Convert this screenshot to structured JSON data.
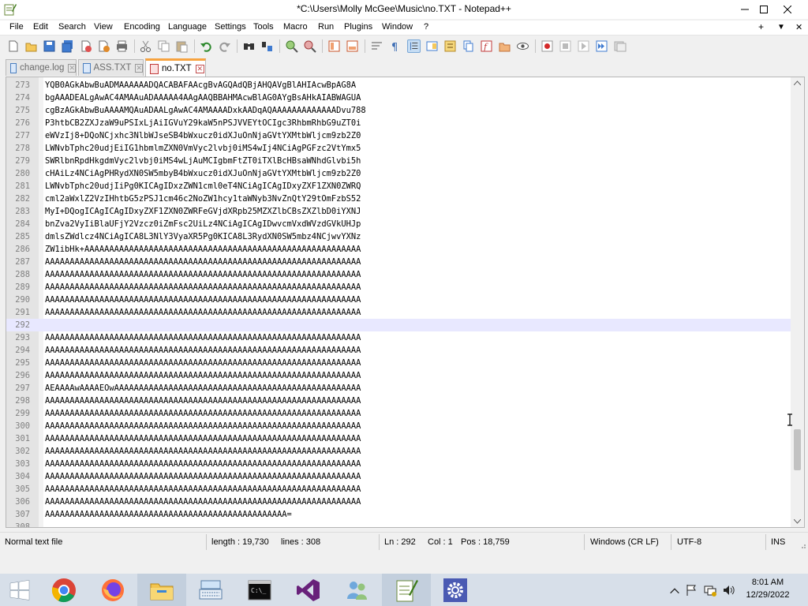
{
  "window": {
    "title": "*C:\\Users\\Molly McGee\\Music\\no.TXT - Notepad++",
    "app_icon": "notepadpp-icon",
    "controls": [
      "minimize-icon",
      "maximize-icon",
      "close-icon"
    ]
  },
  "menubar": {
    "items": [
      "File",
      "Edit",
      "Search",
      "View",
      "Encoding",
      "Language",
      "Settings",
      "Tools",
      "Macro",
      "Run",
      "Plugins",
      "Window",
      "?"
    ],
    "right": [
      "+",
      "▼",
      "✕"
    ]
  },
  "toolbar": {
    "buttons": [
      "new-file-icon",
      "open-file-icon",
      "save-icon",
      "save-all-icon",
      "close-icon",
      "close-all-icon",
      "print-icon",
      "cut-icon",
      "copy-icon",
      "paste-icon",
      "undo-icon",
      "redo-icon",
      "find-icon",
      "replace-icon",
      "zoom-in-icon",
      "zoom-out-icon",
      "sync-vertical-icon",
      "sync-horizontal-icon",
      "word-wrap-icon",
      "show-all-chars-icon",
      "indent-guide-icon",
      "doc-map-icon",
      "function-list-icon",
      "folder-workspace-icon",
      "monitor-icon",
      "record-macro-icon",
      "stop-macro-icon",
      "play-macro-icon",
      "run-macro-multiple-icon",
      "save-macro-icon"
    ]
  },
  "tabs": [
    {
      "label": "change.log",
      "active": false
    },
    {
      "label": "ASS.TXT",
      "active": false
    },
    {
      "label": "no.TXT",
      "active": true
    }
  ],
  "editor": {
    "current_line": 292,
    "lines": [
      {
        "n": "273",
        "t": "YQB0AGkAbwBuADMAAAAAADQACABAFAAcgBvAGQAdQBjAHQAVgBlAHIAcwBpAG8A"
      },
      {
        "n": "274",
        "t": "bgAAADEALgAwAC4AMAAuADAAAAA4AAgAAQBBAHMAcwBlAG0AYgBsAHkAIABWAGUA"
      },
      {
        "n": "275",
        "t": "cgBzAGkAbwBuAAAAMQAuADAALgAwAC4AMAAAADxkAADqAQAAAAAAAAAAAAADvu788"
      },
      {
        "n": "276",
        "t": "P3htbCB2ZXJzaW9uPSIxLjAiIGVuY29kaW5nPSJVVEYtOCIgc3RhbmRhbG9uZT0i"
      },
      {
        "n": "277",
        "t": "eWVzIj8+DQoNCjxhc3NlbWJseSB4bWxucz0idXJuOnNjaGVtYXMtbWljcm9zb2Z0"
      },
      {
        "n": "278",
        "t": "LWNvbTphc20udjEiIG1hbmlmZXN0VmVyc2lvbj0iMS4wIj4NCiAgPGFzc2VtYmx5"
      },
      {
        "n": "279",
        "t": "SWRlbnRpdHkgdmVyc2lvbj0iMS4wLjAuMCIgbmFtZT0iTXlBcHBsaWNhdGlvbi5h"
      },
      {
        "n": "280",
        "t": "cHAiLz4NCiAgPHRydXN0SW5mbyB4bWxucz0idXJuOnNjaGVtYXMtbWljcm9zb2Z0"
      },
      {
        "n": "281",
        "t": "LWNvbTphc20udjIiPg0KICAgIDxzZWN1cml0eT4NCiAgICAgIDxyZXF1ZXN0ZWRQ"
      },
      {
        "n": "282",
        "t": "cml2aWxlZ2VzIHhtbG5zPSJ1cm46c2NoZW1hcy1taWNyb3NvZnQtY29tOmFzbS52"
      },
      {
        "n": "283",
        "t": "MyI+DQogICAgICAgIDxyZXF1ZXN0ZWRFeGVjdXRpb25MZXZlbCBsZXZlbD0iYXNJ"
      },
      {
        "n": "284",
        "t": "bnZva2VyIiBlaUFjY2Vzcz0iZmFsc2UiLz4NCiAgICAgIDwvcmVxdWVzdGVkUHJp"
      },
      {
        "n": "285",
        "t": "dmlsZWdlcz4NCiAgICA8L3NlY3VyaXR5Pg0KICA8L3RydXN0SW5mbz4NCjwvYXNz"
      },
      {
        "n": "286",
        "t": "ZW1ibHk+AAAAAAAAAAAAAAAAAAAAAAAAAAAAAAAAAAAAAAAAAAAAAAAAAAAAAAAA"
      },
      {
        "n": "287",
        "t": "AAAAAAAAAAAAAAAAAAAAAAAAAAAAAAAAAAAAAAAAAAAAAAAAAAAAAAAAAAAAAAAA"
      },
      {
        "n": "288",
        "t": "AAAAAAAAAAAAAAAAAAAAAAAAAAAAAAAAAAAAAAAAAAAAAAAAAAAAAAAAAAAAAAAA"
      },
      {
        "n": "289",
        "t": "AAAAAAAAAAAAAAAAAAAAAAAAAAAAAAAAAAAAAAAAAAAAAAAAAAAAAAAAAAAAAAAA"
      },
      {
        "n": "290",
        "t": "AAAAAAAAAAAAAAAAAAAAAAAAAAAAAAAAAAAAAAAAAAAAAAAAAAAAAAAAAAAAAAAA"
      },
      {
        "n": "291",
        "t": "AAAAAAAAAAAAAAAAAAAAAAAAAAAAAAAAAAAAAAAAAAAAAAAAAAAAAAAAAAAAAAAA"
      },
      {
        "n": "292",
        "t": ""
      },
      {
        "n": "293",
        "t": "AAAAAAAAAAAAAAAAAAAAAAAAAAAAAAAAAAAAAAAAAAAAAAAAAAAAAAAAAAAAAAAA"
      },
      {
        "n": "294",
        "t": "AAAAAAAAAAAAAAAAAAAAAAAAAAAAAAAAAAAAAAAAAAAAAAAAAAAAAAAAAAAAAAAA"
      },
      {
        "n": "295",
        "t": "AAAAAAAAAAAAAAAAAAAAAAAAAAAAAAAAAAAAAAAAAAAAAAAAAAAAAAAAAAAAAAAA"
      },
      {
        "n": "296",
        "t": "AAAAAAAAAAAAAAAAAAAAAAAAAAAAAAAAAAAAAAAAAAAAAAAAAAAAAAAAAAAAAAAA"
      },
      {
        "n": "297",
        "t": "AEAAAAwAAAAEOwAAAAAAAAAAAAAAAAAAAAAAAAAAAAAAAAAAAAAAAAAAAAAAAAAA"
      },
      {
        "n": "298",
        "t": "AAAAAAAAAAAAAAAAAAAAAAAAAAAAAAAAAAAAAAAAAAAAAAAAAAAAAAAAAAAAAAAA"
      },
      {
        "n": "299",
        "t": "AAAAAAAAAAAAAAAAAAAAAAAAAAAAAAAAAAAAAAAAAAAAAAAAAAAAAAAAAAAAAAAA"
      },
      {
        "n": "300",
        "t": "AAAAAAAAAAAAAAAAAAAAAAAAAAAAAAAAAAAAAAAAAAAAAAAAAAAAAAAAAAAAAAAA"
      },
      {
        "n": "301",
        "t": "AAAAAAAAAAAAAAAAAAAAAAAAAAAAAAAAAAAAAAAAAAAAAAAAAAAAAAAAAAAAAAAA"
      },
      {
        "n": "302",
        "t": "AAAAAAAAAAAAAAAAAAAAAAAAAAAAAAAAAAAAAAAAAAAAAAAAAAAAAAAAAAAAAAAA"
      },
      {
        "n": "303",
        "t": "AAAAAAAAAAAAAAAAAAAAAAAAAAAAAAAAAAAAAAAAAAAAAAAAAAAAAAAAAAAAAAAA"
      },
      {
        "n": "304",
        "t": "AAAAAAAAAAAAAAAAAAAAAAAAAAAAAAAAAAAAAAAAAAAAAAAAAAAAAAAAAAAAAAAA"
      },
      {
        "n": "305",
        "t": "AAAAAAAAAAAAAAAAAAAAAAAAAAAAAAAAAAAAAAAAAAAAAAAAAAAAAAAAAAAAAAAA"
      },
      {
        "n": "306",
        "t": "AAAAAAAAAAAAAAAAAAAAAAAAAAAAAAAAAAAAAAAAAAAAAAAAAAAAAAAAAAAAAAAA"
      },
      {
        "n": "307",
        "t": "AAAAAAAAAAAAAAAAAAAAAAAAAAAAAAAAAAAAAAAAAAAAAAAAA="
      },
      {
        "n": "308",
        "t": ""
      }
    ]
  },
  "statusbar": {
    "filetype": "Normal text file",
    "length": "length : 19,730",
    "lines": "lines : 308",
    "ln": "Ln : 292",
    "col": "Col : 1",
    "pos": "Pos : 18,759",
    "eol": "Windows (CR LF)",
    "encoding": "UTF-8",
    "mode": "INS"
  },
  "taskbar": {
    "apps": [
      "windows-start-icon",
      "chrome-icon",
      "firefox-icon",
      "file-explorer-icon",
      "keyboard-app-icon",
      "command-prompt-icon",
      "visual-studio-icon",
      "people-app-icon",
      "notepadpp-icon",
      "settings-gear-icon"
    ],
    "tray": [
      "chevron-up-icon",
      "flag-icon",
      "network-icon",
      "volume-icon"
    ],
    "time": "8:01 AM",
    "date": "12/29/2022"
  },
  "colors": {
    "accent_tab": "#f7a340",
    "current_line": "#e8e8ff",
    "taskbar": "#d7dfe9"
  }
}
